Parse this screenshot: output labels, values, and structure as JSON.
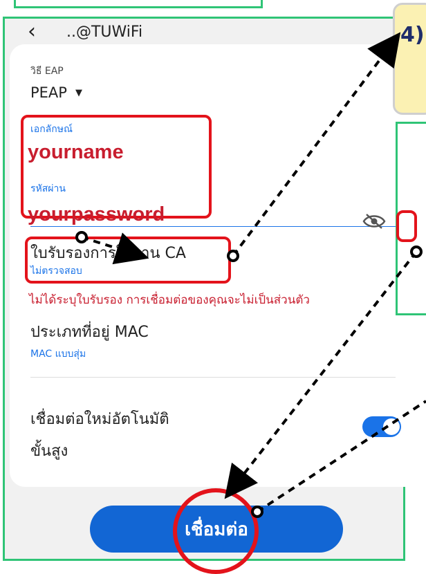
{
  "header": {
    "back_icon": "‹",
    "title": "..@TUWiFi"
  },
  "form": {
    "eap_label": "วิธี EAP",
    "eap_value": "PEAP",
    "dropdown_icon": "▼",
    "identity_label": "เอกลักษณ์",
    "identity_value": "yourname",
    "password_label": "รหัสผ่าน",
    "password_value": "yourpassword",
    "ca_label": "ใบรับรองการใช้งาน CA",
    "ca_value": "ไม่ตรวจสอบ",
    "ca_warning": "ไม่ได้ระบุใบรับรอง การเชื่อมต่อของคุณจะไม่เป็นส่วนตัว",
    "mac_label": "ประเภทที่อยู่ MAC",
    "mac_value": "MAC แบบสุ่ม",
    "autoreconnect_label": "เชื่อมต่อใหม่อัตโนมัติ",
    "autoreconnect_on": true,
    "advanced_label": "ขั้นสูง"
  },
  "connect_button": "เชื่อมต่อ",
  "callout": {
    "text": "4)"
  },
  "colors": {
    "accent": "#1a73e8",
    "highlight": "#e3131b",
    "frame": "#2fc476",
    "warning": "#c81d2e"
  }
}
